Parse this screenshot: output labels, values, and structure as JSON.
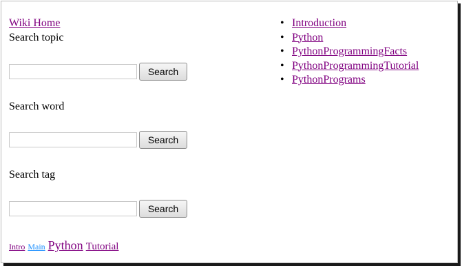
{
  "nav": {
    "home_label": "Wiki Home"
  },
  "search": {
    "topic": {
      "label": "Search topic",
      "value": "",
      "button": "Search"
    },
    "word": {
      "label": "Search word",
      "value": "",
      "button": "Search"
    },
    "tag": {
      "label": "Search tag",
      "value": "",
      "button": "Search"
    }
  },
  "tags": [
    {
      "label": "Intro",
      "color": "#800080"
    },
    {
      "label": "Main",
      "color": "#1e90ff"
    },
    {
      "label": "Python",
      "color": "#800080"
    },
    {
      "label": "Tutorial",
      "color": "#800080"
    }
  ],
  "pages": [
    {
      "label": "Introduction"
    },
    {
      "label": "Python"
    },
    {
      "label": "PythonProgrammingFacts"
    },
    {
      "label": "PythonProgrammingTutorial"
    },
    {
      "label": "PythonPrograms"
    }
  ]
}
